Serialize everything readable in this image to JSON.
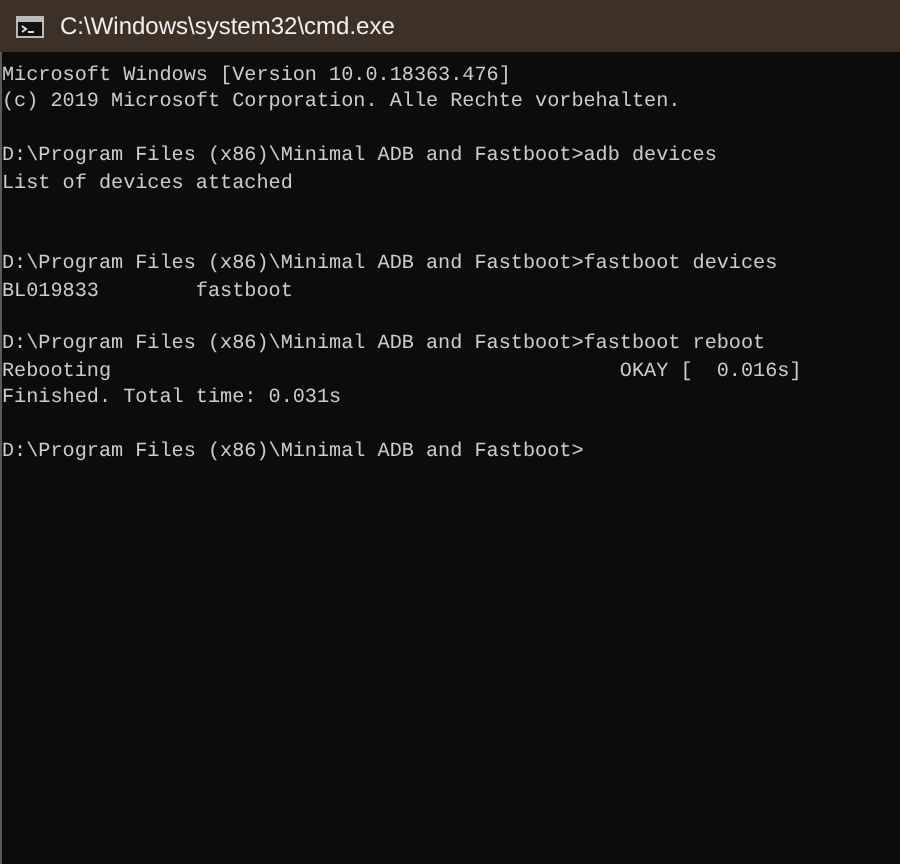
{
  "window": {
    "title": "C:\\Windows\\system32\\cmd.exe"
  },
  "console": {
    "blocks": [
      {
        "lines": [
          "Microsoft Windows [Version 10.0.18363.476]",
          "(c) 2019 Microsoft Corporation. Alle Rechte vorbehalten."
        ]
      },
      {
        "lines": [
          "D:\\Program Files (x86)\\Minimal ADB and Fastboot>adb devices",
          "List of devices attached\n"
        ]
      },
      {
        "lines": [
          "D:\\Program Files (x86)\\Minimal ADB and Fastboot>fastboot devices",
          "BL019833        fastboot"
        ]
      },
      {
        "lines": [
          "D:\\Program Files (x86)\\Minimal ADB and Fastboot>fastboot reboot",
          "Rebooting                                          OKAY [  0.016s]",
          "Finished. Total time: 0.031s"
        ]
      },
      {
        "lines": [
          "D:\\Program Files (x86)\\Minimal ADB and Fastboot>"
        ]
      }
    ]
  }
}
